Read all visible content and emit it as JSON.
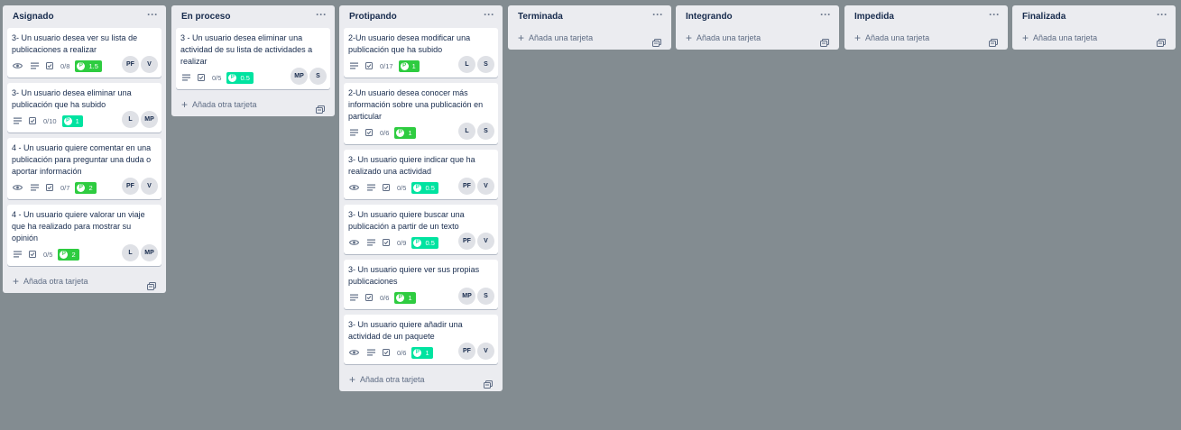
{
  "colors": {
    "board_bg": "#838c91",
    "list_bg": "#ebecf0",
    "green": "#2ecc40",
    "mint": "#00e3a0"
  },
  "lists": [
    {
      "title": "Asignado",
      "add_label": "Añada otra tarjeta",
      "cards": [
        {
          "title": "3- Un usuario desea ver su lista de publicaciones a realizar",
          "watch": true,
          "checklist": "0/8",
          "points": "1.5",
          "points_color": "#2ecc40",
          "members": [
            "PF",
            "V"
          ]
        },
        {
          "title": "3- Un usuario desea eliminar una publicación que ha subido",
          "watch": false,
          "checklist": "0/10",
          "points": "1",
          "points_color": "#00e3a0",
          "members": [
            "L",
            "MP"
          ]
        },
        {
          "title": "4 - Un usuario quiere comentar en una publicación para preguntar una duda o aportar información",
          "watch": true,
          "checklist": "0/7",
          "points": "2",
          "points_color": "#2ecc40",
          "members": [
            "PF",
            "V"
          ]
        },
        {
          "title": "4 - Un usuario quiere valorar un viaje que ha realizado para mostrar su opinión",
          "watch": false,
          "checklist": "0/5",
          "points": "2",
          "points_color": "#2ecc40",
          "members": [
            "L",
            "MP"
          ]
        }
      ]
    },
    {
      "title": "En proceso",
      "add_label": "Añada otra tarjeta",
      "cards": [
        {
          "title": "3 - Un usuario desea eliminar una actividad de su lista de actividades a realizar",
          "watch": false,
          "checklist": "0/5",
          "points": "0.5",
          "points_color": "#00e3a0",
          "members": [
            "MP",
            "S"
          ]
        }
      ]
    },
    {
      "title": "Protipando",
      "add_label": "Añada otra tarjeta",
      "cards": [
        {
          "title": "2-Un usuario desea modificar una publicación que ha subido",
          "watch": false,
          "checklist": "0/17",
          "points": "1",
          "points_color": "#2ecc40",
          "members": [
            "L",
            "S"
          ]
        },
        {
          "title": "2-Un usuario desea conocer más información sobre una publicación en particular",
          "watch": false,
          "checklist": "0/6",
          "points": "1",
          "points_color": "#2ecc40",
          "members": [
            "L",
            "S"
          ]
        },
        {
          "title": "3- Un usuario quiere indicar que ha realizado una actividad",
          "watch": true,
          "checklist": "0/5",
          "points": "0.5",
          "points_color": "#00e3a0",
          "members": [
            "PF",
            "V"
          ]
        },
        {
          "title": "3- Un usuario quiere buscar una publicación a partir de un texto",
          "watch": true,
          "checklist": "0/9",
          "points": "0.5",
          "points_color": "#00e3a0",
          "members": [
            "PF",
            "V"
          ]
        },
        {
          "title": "3- Un usuario quiere ver sus propias publicaciones",
          "watch": false,
          "checklist": "0/6",
          "points": "1",
          "points_color": "#2ecc40",
          "members": [
            "MP",
            "S"
          ]
        },
        {
          "title": "3- Un usuario quiere añadir una actividad de un paquete",
          "watch": true,
          "checklist": "0/6",
          "points": "1",
          "points_color": "#00e3a0",
          "members": [
            "PF",
            "V"
          ]
        }
      ]
    },
    {
      "title": "Terminada",
      "add_label": "Añada una tarjeta",
      "cards": []
    },
    {
      "title": "Integrando",
      "add_label": "Añada una tarjeta",
      "cards": []
    },
    {
      "title": "Impedida",
      "add_label": "Añada una tarjeta",
      "cards": []
    },
    {
      "title": "Finalizada",
      "add_label": "Añada una tarjeta",
      "cards": []
    }
  ]
}
